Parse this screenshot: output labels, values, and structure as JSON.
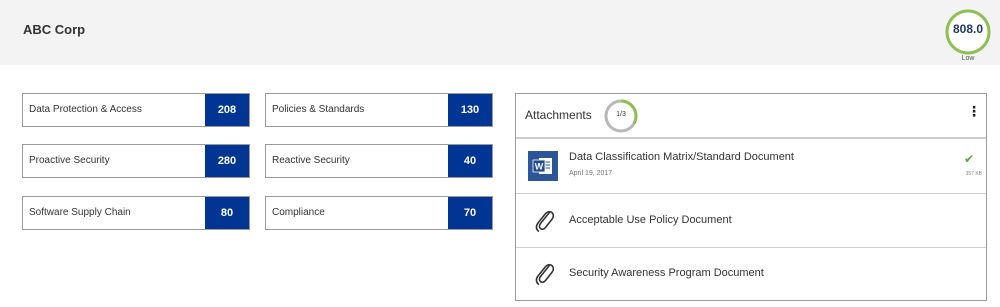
{
  "header": {
    "company": "ABC Corp",
    "score": {
      "value": "808.0",
      "label": "Low",
      "color": "#8cc152"
    }
  },
  "categories": [
    {
      "label": "Data Protection & Access",
      "value": "208"
    },
    {
      "label": "Policies & Standards",
      "value": "130"
    },
    {
      "label": "Proactive Security",
      "value": "280"
    },
    {
      "label": "Reactive Security",
      "value": "40"
    },
    {
      "label": "Software Supply Chain",
      "value": "80"
    },
    {
      "label": "Compliance",
      "value": "70"
    }
  ],
  "attachments": {
    "title": "Attachments",
    "count": "1/3",
    "count_fraction": 0.333,
    "items": [
      {
        "name": "Data Classification Matrix/Standard Document",
        "date": "April 19, 2017",
        "size": "357 KB",
        "icon": "word-document-icon",
        "uploaded": true
      },
      {
        "name": "Acceptable Use Policy Document",
        "icon": "paperclip-icon",
        "uploaded": false
      },
      {
        "name": "Security Awareness Program Document",
        "icon": "paperclip-icon",
        "uploaded": false
      }
    ]
  },
  "colors": {
    "value_box": "#003594",
    "header_bg": "#f3f3f3",
    "success": "#5aa33a",
    "ring_progress": "#8cc152",
    "ring_track": "#b8b8b8"
  }
}
